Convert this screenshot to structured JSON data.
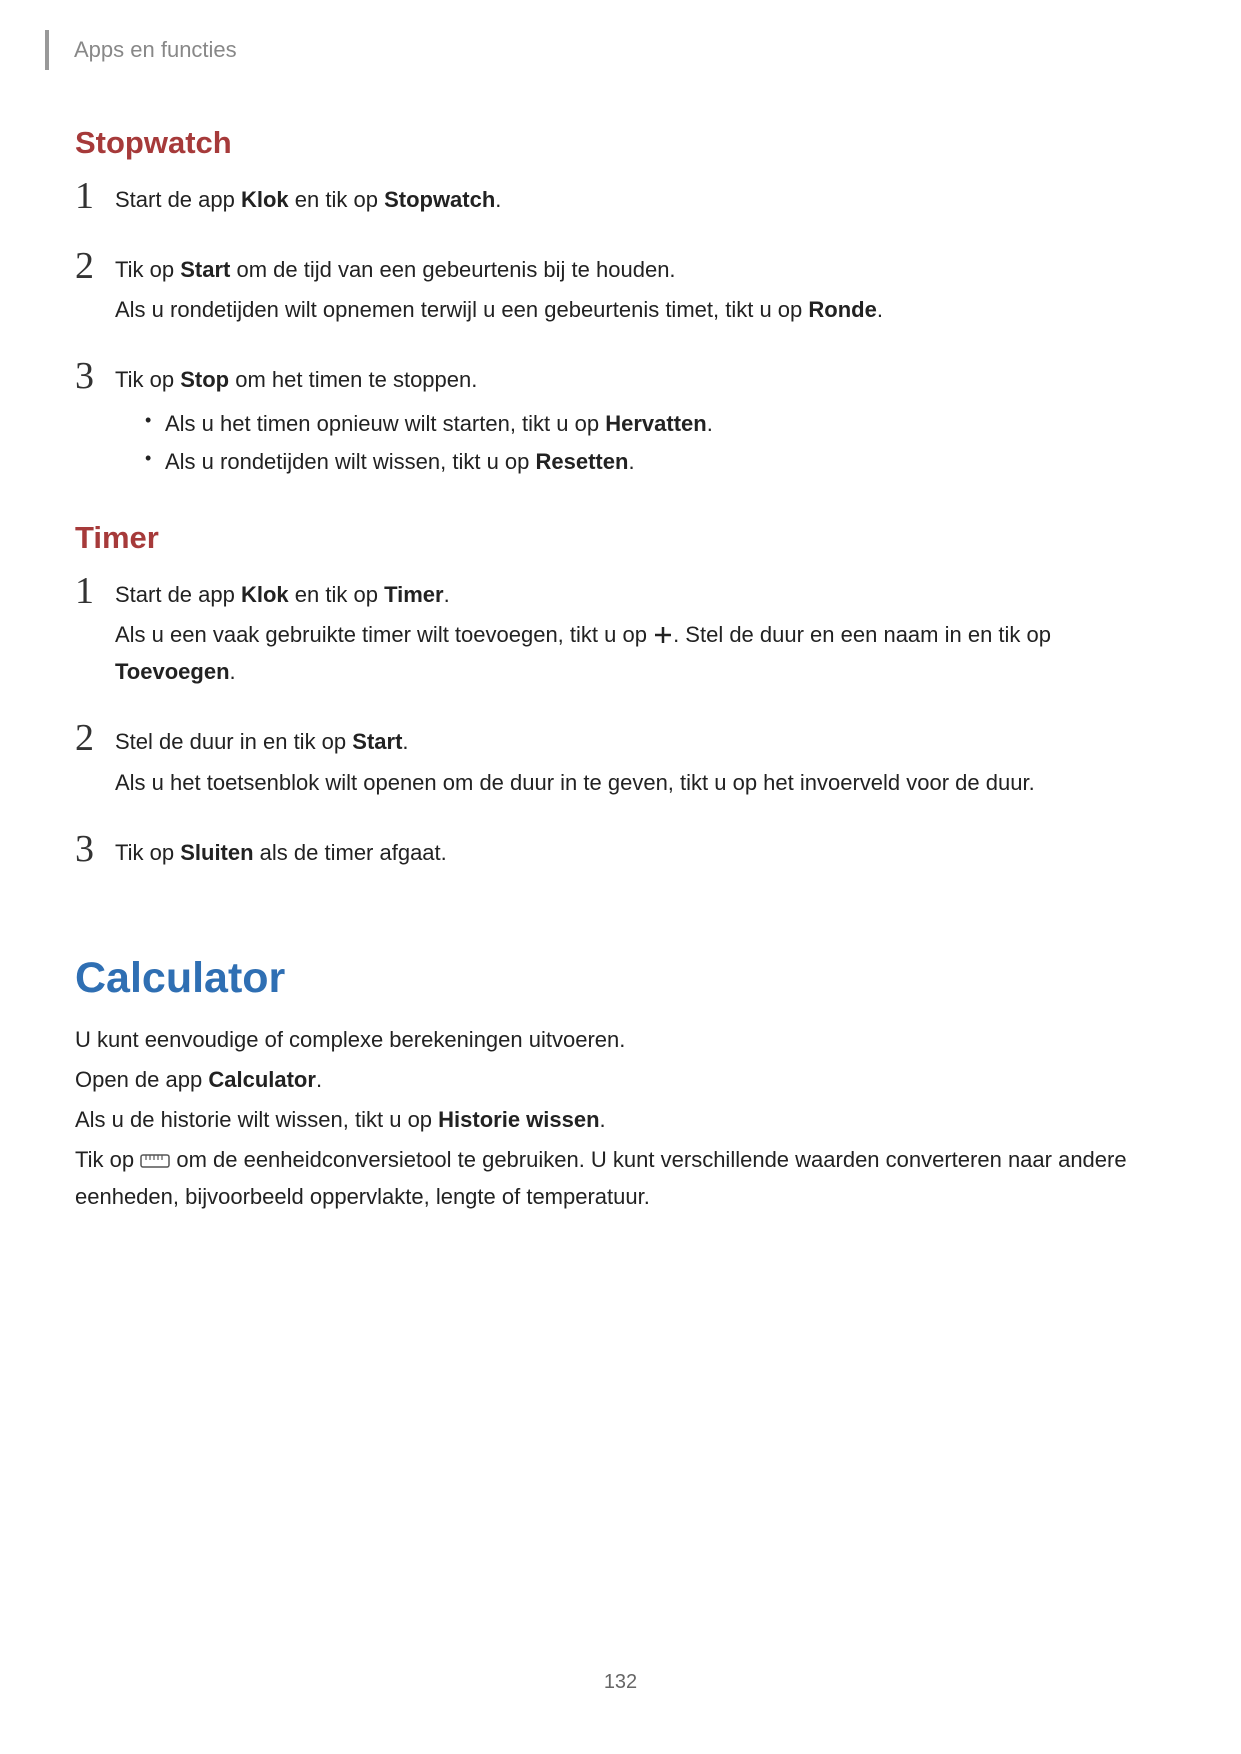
{
  "header": {
    "breadcrumb": "Apps en functies"
  },
  "stopwatch": {
    "title": "Stopwatch",
    "steps": [
      {
        "num": "1",
        "line_a1": "Start de app ",
        "line_a2": "Klok",
        "line_a3": " en tik op ",
        "line_a4": "Stopwatch",
        "line_a5": "."
      },
      {
        "num": "2",
        "line_a1": "Tik op ",
        "line_a2": "Start",
        "line_a3": " om de tijd van een gebeurtenis bij te houden.",
        "line_b1": "Als u rondetijden wilt opnemen terwijl u een gebeurtenis timet, tikt u op ",
        "line_b2": "Ronde",
        "line_b3": "."
      },
      {
        "num": "3",
        "line_a1": "Tik op ",
        "line_a2": "Stop",
        "line_a3": " om het timen te stoppen.",
        "bullet1_a": "Als u het timen opnieuw wilt starten, tikt u op ",
        "bullet1_b": "Hervatten",
        "bullet1_c": ".",
        "bullet2_a": "Als u rondetijden wilt wissen, tikt u op ",
        "bullet2_b": "Resetten",
        "bullet2_c": "."
      }
    ]
  },
  "timer": {
    "title": "Timer",
    "steps": [
      {
        "num": "1",
        "line_a1": "Start de app ",
        "line_a2": "Klok",
        "line_a3": " en tik op ",
        "line_a4": "Timer",
        "line_a5": ".",
        "line_b1": "Als u een vaak gebruikte timer wilt toevoegen, tikt u op ",
        "line_b2": ". Stel de duur en een naam in en tik op ",
        "line_b3": "Toevoegen",
        "line_b4": "."
      },
      {
        "num": "2",
        "line_a1": "Stel de duur in en tik op ",
        "line_a2": "Start",
        "line_a3": ".",
        "line_b1": "Als u het toetsenblok wilt openen om de duur in te geven, tikt u op het invoerveld voor de duur."
      },
      {
        "num": "3",
        "line_a1": "Tik op ",
        "line_a2": "Sluiten",
        "line_a3": " als de timer afgaat."
      }
    ]
  },
  "calculator": {
    "title": "Calculator",
    "p1": "U kunt eenvoudige of complexe berekeningen uitvoeren.",
    "p2_a": "Open de app ",
    "p2_b": "Calculator",
    "p2_c": ".",
    "p3_a": "Als u de historie wilt wissen, tikt u op ",
    "p3_b": "Historie wissen",
    "p3_c": ".",
    "p4_a": "Tik op ",
    "p4_b": " om de eenheidconversietool te gebruiken. U kunt verschillende waarden converteren naar andere eenheden, bijvoorbeeld oppervlakte, lengte of temperatuur."
  },
  "page_number": "132"
}
